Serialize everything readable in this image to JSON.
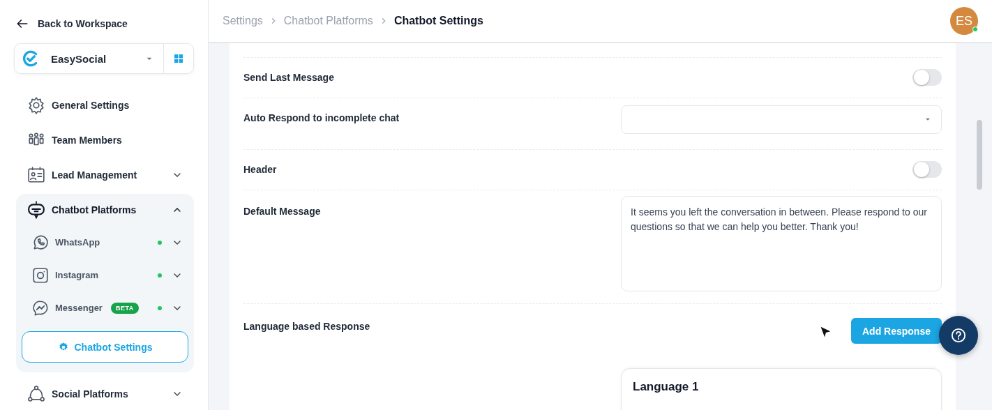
{
  "sidebar": {
    "back_link": "Back to Workspace",
    "workspace": {
      "name": "EasySocial"
    },
    "items": [
      {
        "label": "General Settings"
      },
      {
        "label": "Team Members"
      },
      {
        "label": "Lead Management",
        "expandable": true,
        "expanded": false
      },
      {
        "label": "Chatbot Platforms",
        "expandable": true,
        "expanded": true,
        "children": [
          {
            "label": "WhatsApp",
            "color": "#22c55e",
            "expanded": false
          },
          {
            "label": "Instagram",
            "color": "#22c55e",
            "expanded": false
          },
          {
            "label": "Messenger",
            "badge": "BETA",
            "color": "#22c55e",
            "expanded": false
          }
        ],
        "sub_button": {
          "label": "Chatbot Settings",
          "selected": true
        }
      },
      {
        "label": "Social Platforms",
        "expandable": true,
        "expanded": false
      }
    ]
  },
  "breadcrumb": [
    {
      "label": "Settings",
      "current": false
    },
    {
      "label": "Chatbot Platforms",
      "current": false
    },
    {
      "label": "Chatbot Settings",
      "current": true
    }
  ],
  "user": {
    "initials": "ES",
    "online": true
  },
  "settings": [
    {
      "kind": "toggle",
      "label": "Send Last Message",
      "on": false
    },
    {
      "kind": "select",
      "label": "Auto Respond to incomplete chat"
    },
    {
      "kind": "toggle",
      "label": "Header",
      "on": false
    },
    {
      "kind": "textarea",
      "label": "Default Message",
      "value": "It seems you left the conversation in between. Please respond to our questions so that we can help you better. Thank you!"
    },
    {
      "kind": "button",
      "label": "Language based Response",
      "button": "Add Response"
    }
  ],
  "language_card": {
    "title": "Language 1"
  }
}
